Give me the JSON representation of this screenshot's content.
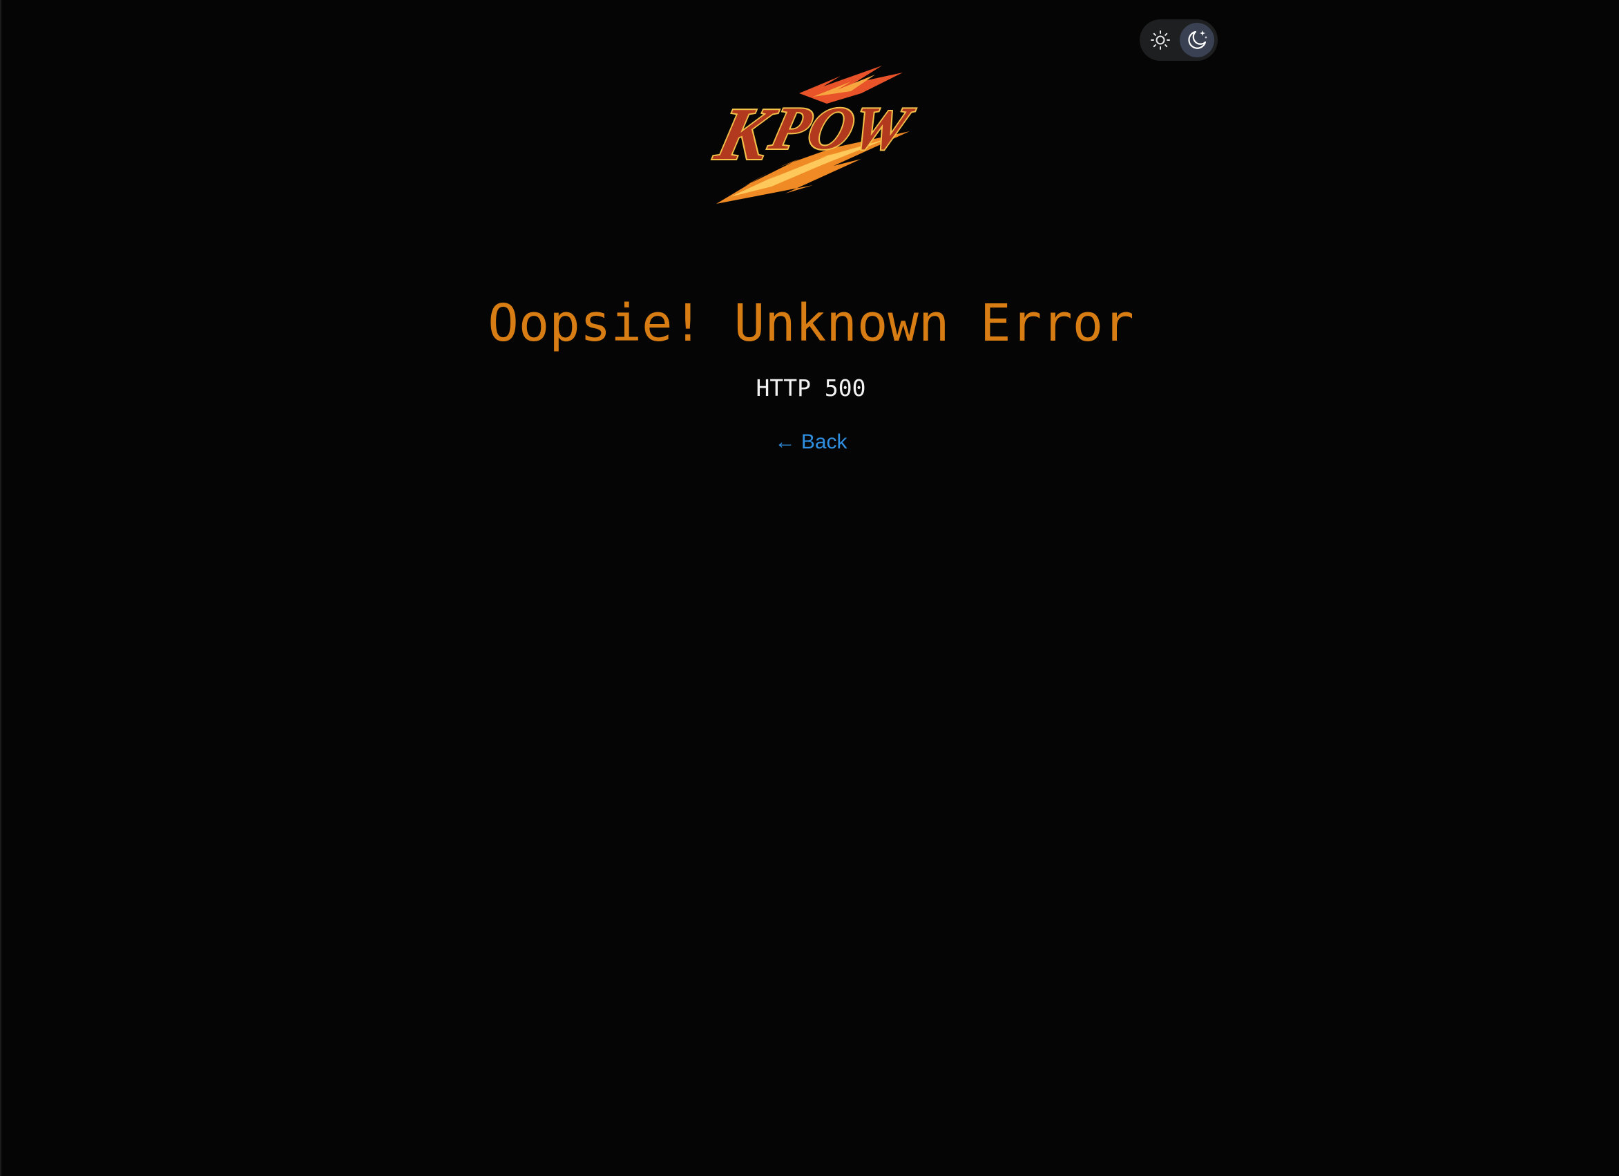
{
  "theme_toggle": {
    "light_icon": "sun-icon",
    "dark_icon": "moon-stars-icon",
    "active": "dark"
  },
  "logo": {
    "text": "KPOW",
    "icon": "kpow-logo"
  },
  "error": {
    "title": "Oopsie! Unknown Error",
    "code": "HTTP 500"
  },
  "navigation": {
    "back_arrow": "←",
    "back_label": "Back"
  },
  "colors": {
    "background": "#050505",
    "title": "#d87d14",
    "link": "#2f8fe0",
    "toggle_active": "#3a4152"
  }
}
